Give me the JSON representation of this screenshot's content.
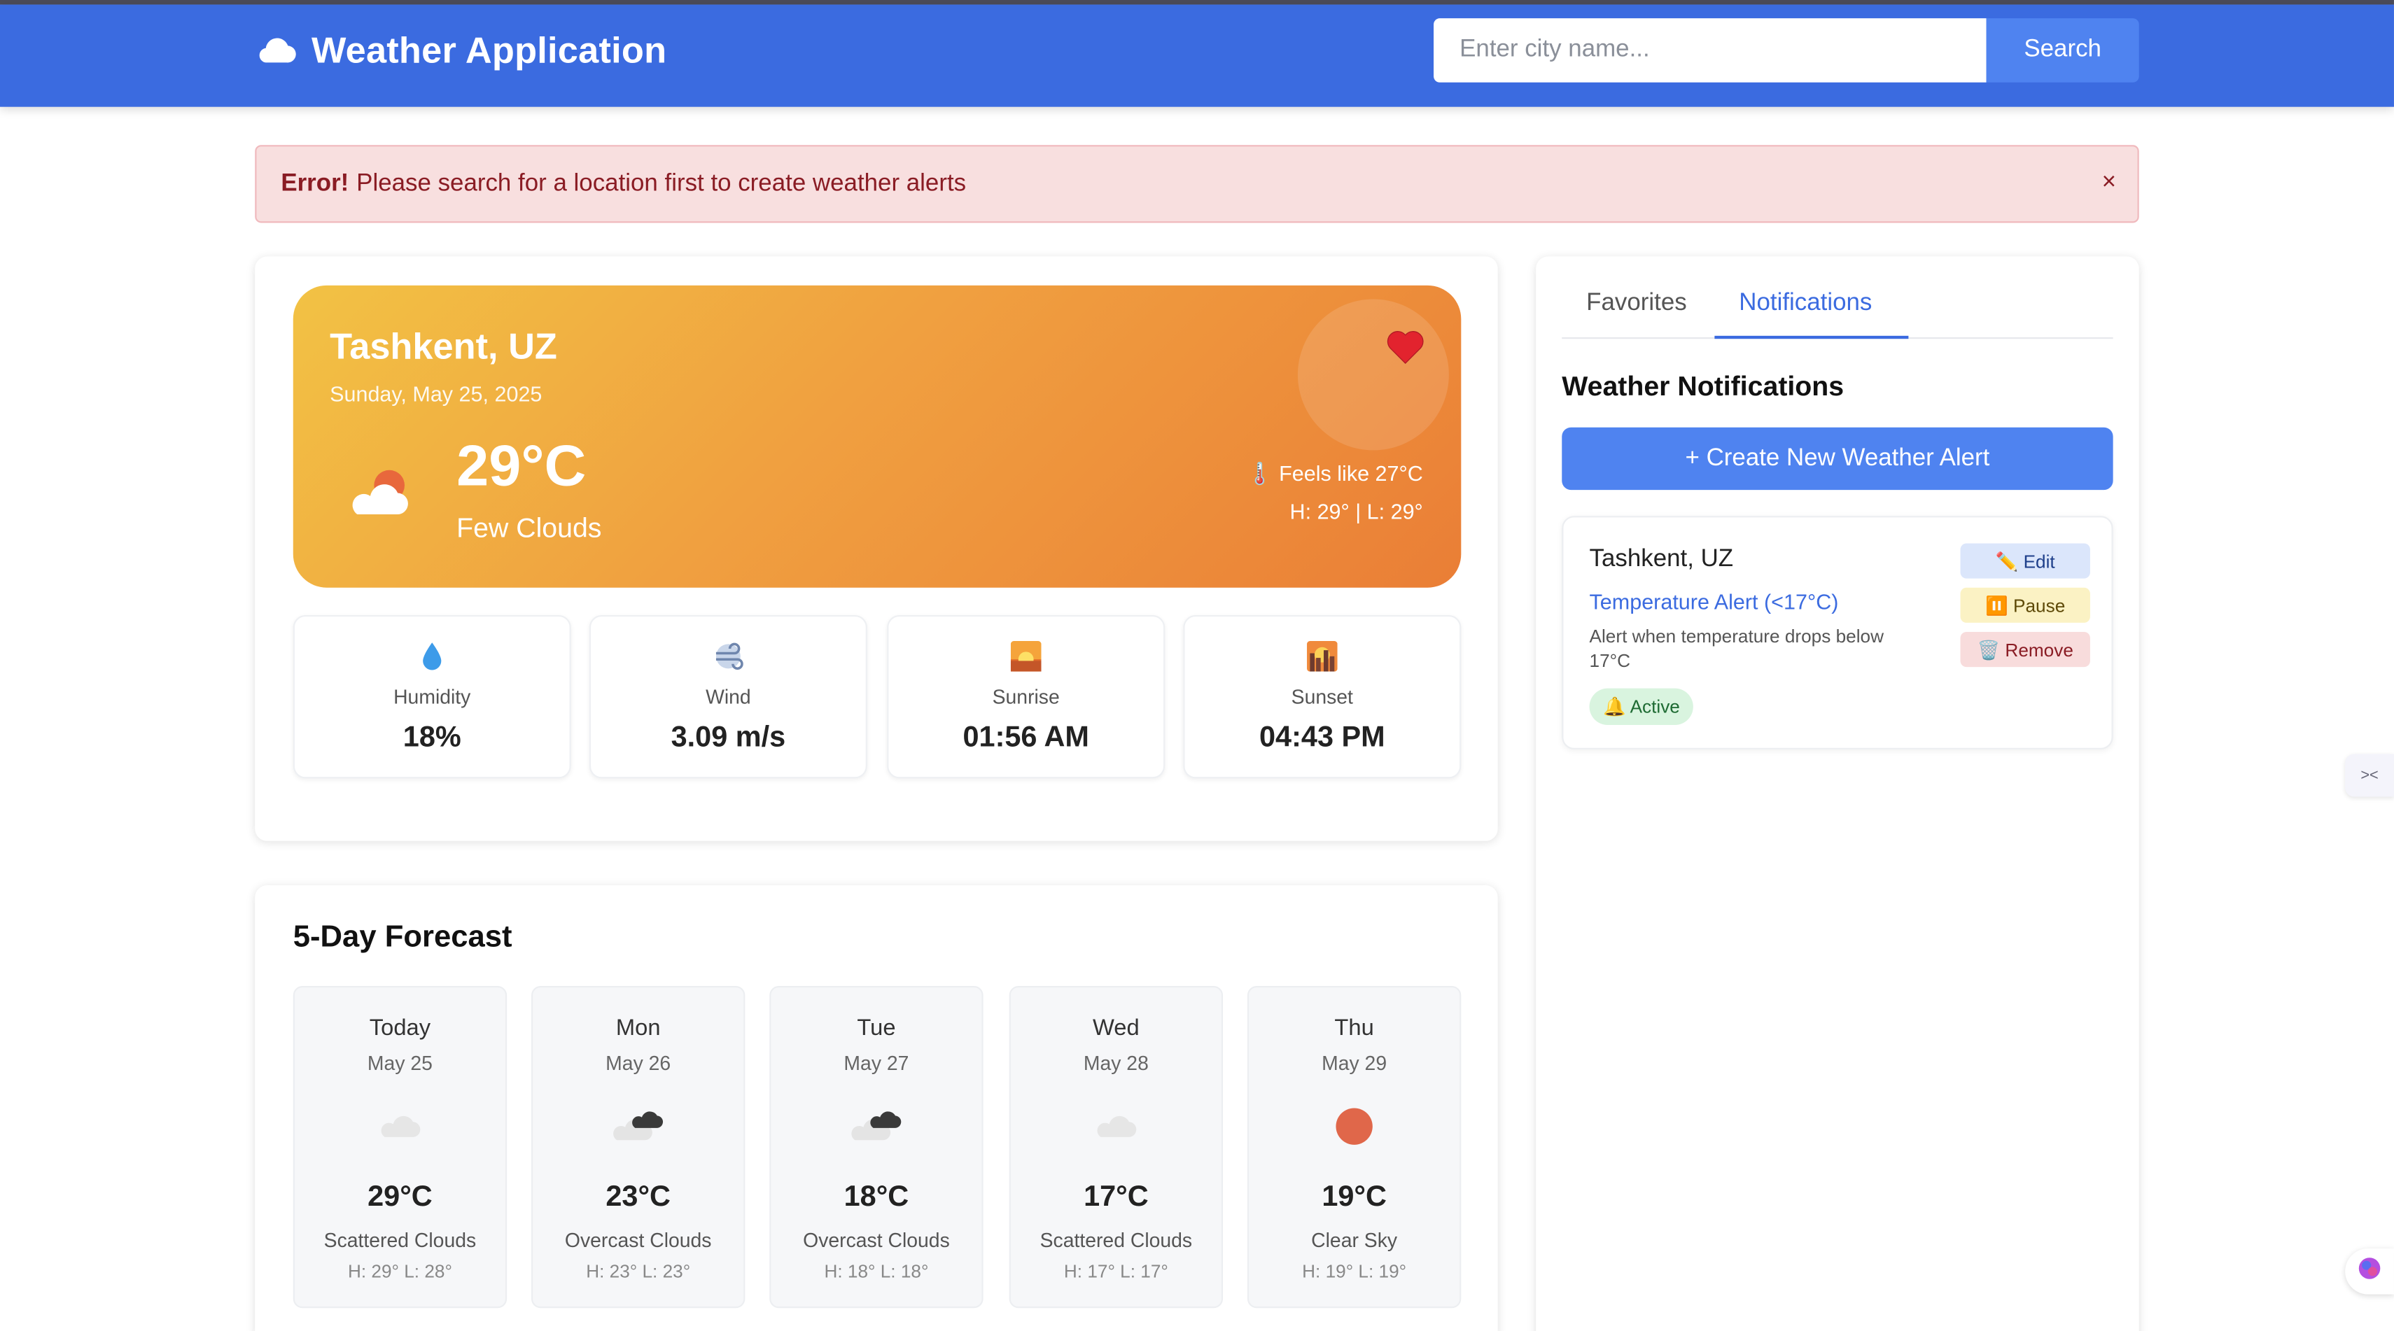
{
  "navbar": {
    "title": "Weather Application",
    "logo_icon": "cloud-icon",
    "search_placeholder": "Enter city name...",
    "search_value": "",
    "search_button": "Search",
    "color": "#3b6be0"
  },
  "alert": {
    "strong": "Error!",
    "message": "Please search for a location first to create weather alerts",
    "close": "×"
  },
  "current": {
    "city": "Tashkent, UZ",
    "date": "Sunday, May 25, 2025",
    "temperature": "29°C",
    "description": "Few Clouds",
    "feels_like": "🌡️ Feels like 27°C",
    "high_low": "H: 29° | L: 29°",
    "favorite_icon": "heart-icon",
    "weather_icon": "few-clouds-icon"
  },
  "stats": [
    {
      "label": "Humidity",
      "value": "18%",
      "icon": "droplet-icon"
    },
    {
      "label": "Wind",
      "value": "3.09 m/s",
      "icon": "wind-icon"
    },
    {
      "label": "Sunrise",
      "value": "01:56 AM",
      "icon": "sunrise-icon"
    },
    {
      "label": "Sunset",
      "value": "04:43 PM",
      "icon": "sunset-icon"
    }
  ],
  "forecast": {
    "title": "5-Day Forecast",
    "days": [
      {
        "day": "Today",
        "date": "May 25",
        "temp": "29°C",
        "desc": "Scattered Clouds",
        "hl": "H: 29° L: 28°",
        "icon": "scattered-clouds-icon"
      },
      {
        "day": "Mon",
        "date": "May 26",
        "temp": "23°C",
        "desc": "Overcast Clouds",
        "hl": "H: 23° L: 23°",
        "icon": "overcast-clouds-icon"
      },
      {
        "day": "Tue",
        "date": "May 27",
        "temp": "18°C",
        "desc": "Overcast Clouds",
        "hl": "H: 18° L: 18°",
        "icon": "overcast-clouds-icon"
      },
      {
        "day": "Wed",
        "date": "May 28",
        "temp": "17°C",
        "desc": "Scattered Clouds",
        "hl": "H: 17° L: 17°",
        "icon": "scattered-clouds-icon"
      },
      {
        "day": "Thu",
        "date": "May 29",
        "temp": "19°C",
        "desc": "Clear Sky",
        "hl": "H: 19° L: 19°",
        "icon": "clear-sky-icon"
      }
    ]
  },
  "sidebar": {
    "tabs": [
      {
        "label": "Favorites",
        "active": false
      },
      {
        "label": "Notifications",
        "active": true
      }
    ],
    "title": "Weather Notifications",
    "create_button": "+ Create New Weather Alert",
    "alerts": [
      {
        "city": "Tashkent, UZ",
        "type": "Temperature Alert (<17°C)",
        "description": "Alert when temperature drops below 17°C",
        "status": "🔔 Active",
        "edit": "✏️ Edit",
        "pause": "⏸️ Pause",
        "remove": "🗑️ Remove"
      }
    ]
  }
}
